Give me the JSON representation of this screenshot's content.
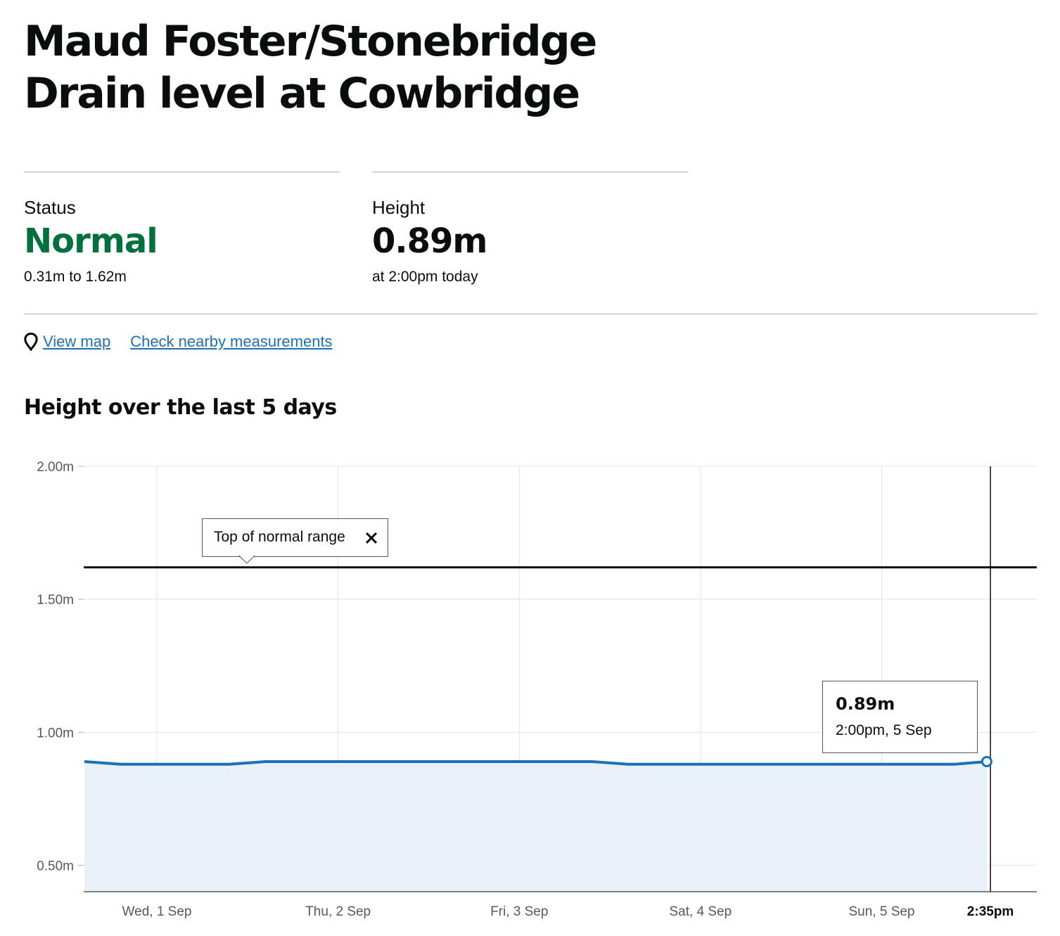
{
  "page": {
    "title": "Maud Foster/Stonebridge Drain level at Cowbridge"
  },
  "status": {
    "label": "Status",
    "value": "Normal",
    "range": "0.31m to 1.62m",
    "color": "#00703c"
  },
  "height": {
    "label": "Height",
    "value": "0.89m",
    "time": "at 2:00pm today"
  },
  "links": {
    "map_icon": "map-pin-icon",
    "view_map": "View map",
    "nearby": "Check nearby measurements"
  },
  "chart_heading": "Height over the last 5 days",
  "chart_data": {
    "type": "area",
    "title": "Height over the last 5 days",
    "y_unit": "m",
    "ylim": [
      0.4,
      2.0
    ],
    "y_ticks": [
      "2.00m",
      "1.50m",
      "1.00m",
      "0.50m"
    ],
    "y_tick_values": [
      2.0,
      1.5,
      1.0,
      0.5
    ],
    "x_tick_labels": [
      "Wed, 1 Sep",
      "Thu, 2 Sep",
      "Fri, 3 Sep",
      "Sat, 4 Sep",
      "Sun, 5 Sep"
    ],
    "x_tick_days": [
      1,
      2,
      3,
      4,
      5
    ],
    "x_range_days": [
      0.6,
      5.6
    ],
    "now_label": "2:35pm",
    "now_day": 5.6,
    "grid": true,
    "line_color": "#1d70b8",
    "fill_color": "#e8f1f8",
    "threshold": {
      "label": "Top of normal range",
      "value": 1.62
    },
    "series": [
      {
        "x": [
          0.6,
          0.8,
          1.0,
          1.2,
          1.4,
          1.6,
          1.8,
          2.0,
          2.2,
          2.4,
          2.6,
          2.8,
          3.0,
          3.2,
          3.4,
          3.6,
          3.8,
          4.0,
          4.2,
          4.4,
          4.6,
          4.8,
          5.0,
          5.2,
          5.4,
          5.58
        ],
        "y": [
          0.89,
          0.88,
          0.88,
          0.88,
          0.88,
          0.89,
          0.89,
          0.89,
          0.89,
          0.89,
          0.89,
          0.89,
          0.89,
          0.89,
          0.89,
          0.88,
          0.88,
          0.88,
          0.88,
          0.88,
          0.88,
          0.88,
          0.88,
          0.88,
          0.88,
          0.89
        ]
      }
    ],
    "tooltip": {
      "value": "0.89m",
      "time": "2:00pm, 5 Sep",
      "x": 5.58,
      "y": 0.89
    }
  }
}
